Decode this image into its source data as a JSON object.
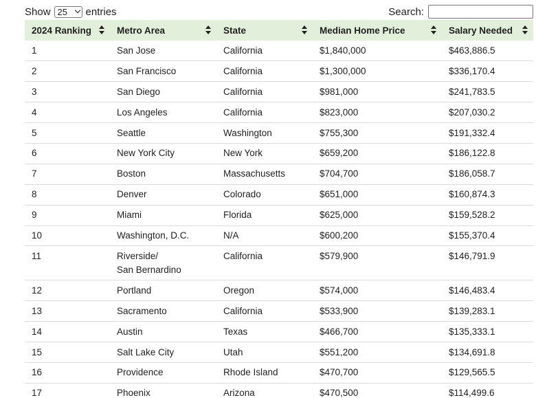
{
  "controls": {
    "show_label": "Show",
    "entries_value": "25",
    "entries_label": "entries",
    "search_label": "Search:",
    "search_value": ""
  },
  "table": {
    "headers": [
      "2024 Ranking",
      "Metro Area",
      "State",
      "Median Home Price",
      "Salary Needed"
    ],
    "rows": [
      {
        "rank": "1",
        "metro": "San Jose",
        "metro2": "",
        "state": "California",
        "price": "$1,840,000",
        "salary": "$463,886.5"
      },
      {
        "rank": "2",
        "metro": "San Francisco",
        "metro2": "",
        "state": "California",
        "price": "$1,300,000",
        "salary": "$336,170.4"
      },
      {
        "rank": "3",
        "metro": "San Diego",
        "metro2": "",
        "state": "California",
        "price": "$981,000",
        "salary": "$241,783.5"
      },
      {
        "rank": "4",
        "metro": "Los Angeles",
        "metro2": "",
        "state": "California",
        "price": "$823,000",
        "salary": "$207,030.2"
      },
      {
        "rank": "5",
        "metro": "Seattle",
        "metro2": "",
        "state": "Washington",
        "price": "$755,300",
        "salary": "$191,332.4"
      },
      {
        "rank": "6",
        "metro": "New York City",
        "metro2": "",
        "state": "New York",
        "price": "$659,200",
        "salary": "$186,122.8"
      },
      {
        "rank": "7",
        "metro": "Boston",
        "metro2": "",
        "state": "Massachusetts",
        "price": "$704,700",
        "salary": "$186,058.7"
      },
      {
        "rank": "8",
        "metro": "Denver",
        "metro2": "",
        "state": "Colorado",
        "price": "$651,000",
        "salary": "$160,874.3"
      },
      {
        "rank": "9",
        "metro": "Miami",
        "metro2": "",
        "state": "Florida",
        "price": "$625,000",
        "salary": "$159,528.2"
      },
      {
        "rank": "10",
        "metro": "Washington, D.C.",
        "metro2": "",
        "state": "N/A",
        "price": "$600,200",
        "salary": "$155,370.4"
      },
      {
        "rank": "11",
        "metro": "Riverside/",
        "metro2": "San Bernardino",
        "state": "California",
        "price": "$579,900",
        "salary": "$146,791.9"
      },
      {
        "rank": "12",
        "metro": "Portland",
        "metro2": "",
        "state": "Oregon",
        "price": "$574,000",
        "salary": "$146,483.4"
      },
      {
        "rank": "13",
        "metro": "Sacramento",
        "metro2": "",
        "state": "California",
        "price": "$533,900",
        "salary": "$139,283.1"
      },
      {
        "rank": "14",
        "metro": "Austin",
        "metro2": "",
        "state": "Texas",
        "price": "$466,700",
        "salary": "$135,333.1"
      },
      {
        "rank": "15",
        "metro": "Salt Lake City",
        "metro2": "",
        "state": "Utah",
        "price": "$551,200",
        "salary": "$134,691.8"
      },
      {
        "rank": "16",
        "metro": "Providence",
        "metro2": "",
        "state": "Rhode Island",
        "price": "$470,700",
        "salary": "$129,565.5"
      },
      {
        "rank": "17",
        "metro": "Phoenix",
        "metro2": "",
        "state": "Arizona",
        "price": "$470,500",
        "salary": "$114,499.6"
      }
    ]
  },
  "colors": {
    "header_bg": "#e2efda",
    "row_border": "#dcdcdc",
    "text": "#222222"
  }
}
